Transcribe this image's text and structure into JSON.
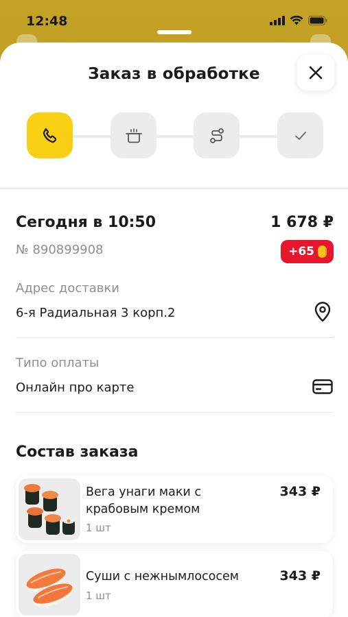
{
  "status_bar": {
    "time": "12:48"
  },
  "sheet": {
    "title": "Заказ в обработке"
  },
  "steps": [
    {
      "name": "phone-icon",
      "active": true
    },
    {
      "name": "cooking-pot-icon",
      "active": false
    },
    {
      "name": "route-icon",
      "active": false
    },
    {
      "name": "checkmark-icon",
      "active": false
    }
  ],
  "order": {
    "date": "Сегодня в 10:50",
    "total": "1 678 ₽",
    "number": "№ 890899908",
    "bonus": "+65"
  },
  "delivery": {
    "label": "Адрес доставки",
    "value": "6-я Радиальная 3 корп.2"
  },
  "payment": {
    "label": "Типо оплаты",
    "value": "Онлайн про карте"
  },
  "composition": {
    "title": "Состав заказа",
    "items": [
      {
        "name": "Вега унаги маки с крабовым кремом",
        "qty": "1 шт",
        "price": "343 ₽"
      },
      {
        "name": "Суши с нежнымлососем",
        "qty": "1 шт",
        "price": "343 ₽"
      }
    ]
  },
  "colors": {
    "accent_yellow": "#f9cf14",
    "badge_red": "#e6172d",
    "muted_text": "#8e8e8e"
  }
}
